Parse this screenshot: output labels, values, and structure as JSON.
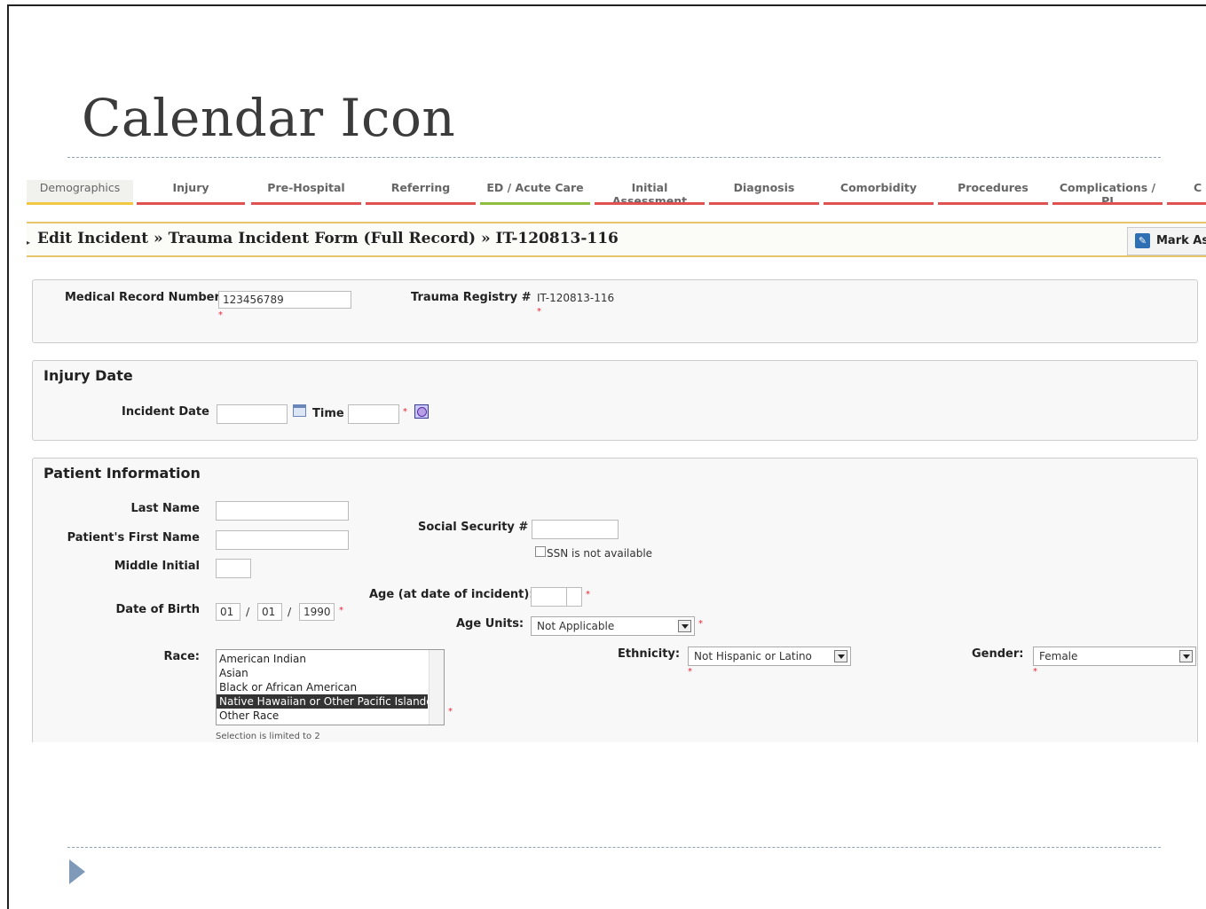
{
  "slide": {
    "title": "Calendar Icon"
  },
  "tabs": [
    "Demographics",
    "Injury",
    "Pre-Hospital",
    "Referring",
    "ED / Acute Care",
    "Initial Assessment",
    "Diagnosis",
    "Comorbidity",
    "Procedures",
    "Complications / PI",
    "C"
  ],
  "editbar": {
    "title": "Edit Incident » Trauma Incident Form (Full Record) » IT-120813-116",
    "mark_as": "Mark As"
  },
  "record": {
    "mrn_label": "Medical Record Number",
    "mrn_value": "123456789",
    "registry_label": "Trauma Registry #",
    "registry_value": "IT-120813-116"
  },
  "injury": {
    "heading": "Injury Date",
    "incident_date_label": "Incident Date",
    "time_label": "Time"
  },
  "patient": {
    "heading": "Patient Information",
    "last_name_label": "Last Name",
    "first_name_label": "Patient's First Name",
    "middle_initial_label": "Middle Initial",
    "dob_label": "Date of Birth",
    "dob_month": "01",
    "dob_day": "01",
    "dob_year": "1990",
    "dob_sep": "/",
    "ssn_label": "Social Security #",
    "ssn_na_label": "SSN is not available",
    "age_label": "Age (at date of incident):",
    "age_units_label": "Age Units:",
    "age_units_value": "Not Applicable",
    "race_label": "Race:",
    "race_options": [
      "American Indian",
      "Asian",
      "Black or African American",
      "Native Hawaiian or Other Pacific Islander",
      "Other Race"
    ],
    "race_note": "Selection is limited to 2",
    "ethnicity_label": "Ethnicity:",
    "ethnicity_value": "Not Hispanic or Latino",
    "gender_label": "Gender:",
    "gender_value": "Female"
  },
  "required_mark": "*"
}
